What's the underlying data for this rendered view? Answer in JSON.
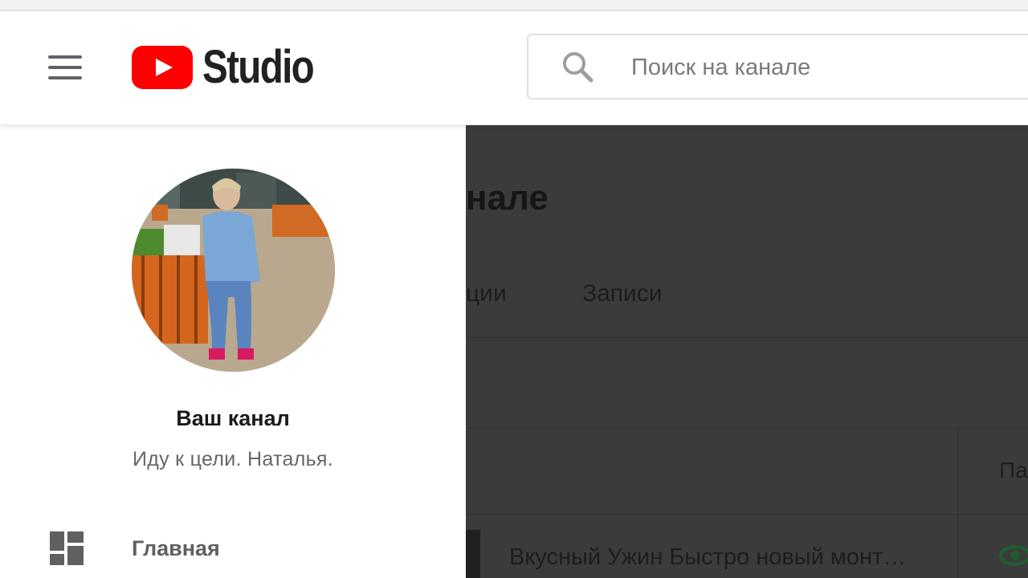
{
  "header": {
    "logo_text": "Studio",
    "search_placeholder": "Поиск на канале"
  },
  "sidebar": {
    "channel_title": "Ваш канал",
    "channel_name": "Иду к цели. Наталья.",
    "items": [
      {
        "label": "Главная",
        "icon": "dashboard-icon"
      }
    ]
  },
  "main": {
    "title_fragment": "нале",
    "tabs": [
      {
        "label": "ции"
      },
      {
        "label": "Записи"
      }
    ],
    "column_header_fragment": "Па",
    "rows": [
      {
        "title": "Вкусный Ужин Быстро новый монт…",
        "visibility_icon": "eye-icon"
      }
    ]
  },
  "colors": {
    "brand_red": "#ff0000",
    "overlay": "#3b3b3b",
    "visibility_green": "#1e8e3e"
  }
}
